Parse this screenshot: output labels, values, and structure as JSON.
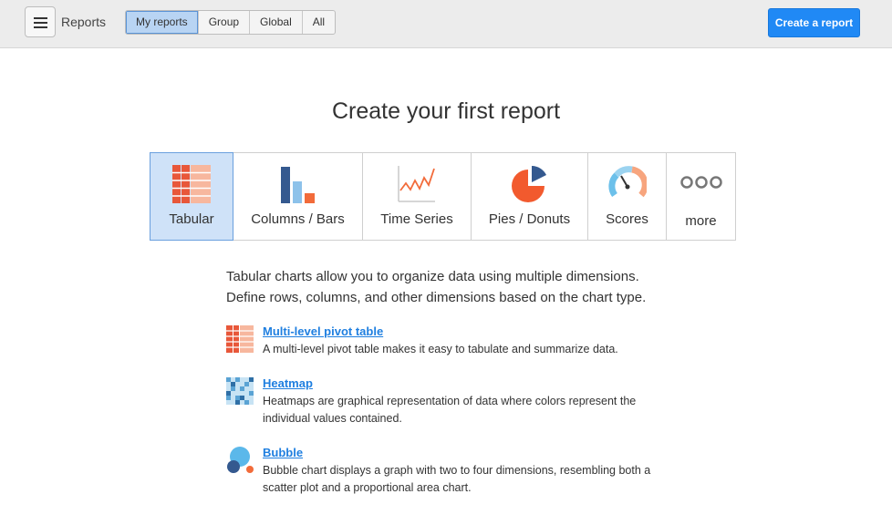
{
  "header": {
    "app_title": "Reports",
    "menu_icon": "hamburger-icon",
    "tabs": [
      {
        "label": "My reports",
        "active": true
      },
      {
        "label": "Group",
        "active": false
      },
      {
        "label": "Global",
        "active": false
      },
      {
        "label": "All",
        "active": false
      }
    ],
    "create_label": "Create a report",
    "accent_color": "#2089f5"
  },
  "main": {
    "title": "Create your first report",
    "chart_types": [
      {
        "label": "Tabular",
        "icon": "tabular-icon",
        "active": true
      },
      {
        "label": "Columns / Bars",
        "icon": "columns-bars-icon",
        "active": false
      },
      {
        "label": "Time Series",
        "icon": "time-series-icon",
        "active": false
      },
      {
        "label": "Pies / Donuts",
        "icon": "pie-donut-icon",
        "active": false
      },
      {
        "label": "Scores",
        "icon": "scores-gauge-icon",
        "active": false
      },
      {
        "label": "more",
        "icon": "more-dots-icon",
        "active": false
      }
    ],
    "description_line1": "Tabular charts allow you to organize data using multiple dimensions.",
    "description_line2": "Define rows, columns, and other dimensions based on the chart type.",
    "options": [
      {
        "title": "Multi-level pivot table",
        "text": "A multi-level pivot table makes it easy to tabulate and summarize data.",
        "icon": "pivot-table-icon"
      },
      {
        "title": "Heatmap",
        "text": "Heatmaps are graphical representation of data where colors represent the individual values contained.",
        "icon": "heatmap-icon"
      },
      {
        "title": "Bubble",
        "text": "Bubble chart displays a graph with two to four dimensions, resembling both a scatter plot and a proportional area chart.",
        "icon": "bubble-icon"
      }
    ]
  }
}
